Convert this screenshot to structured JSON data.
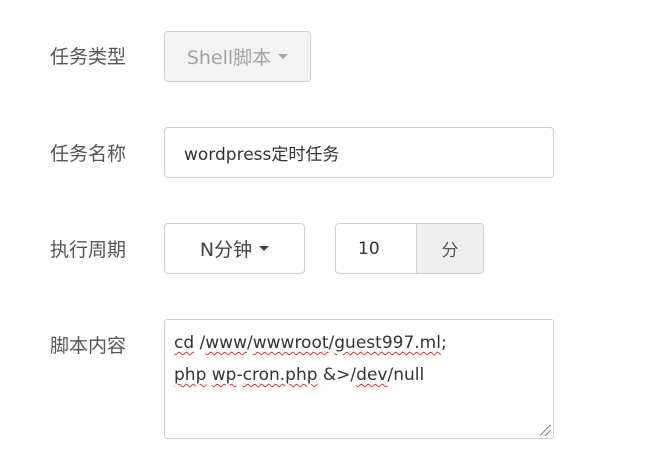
{
  "form": {
    "task_type": {
      "label": "任务类型",
      "value": "Shell脚本"
    },
    "task_name": {
      "label": "任务名称",
      "value": "wordpress定时任务"
    },
    "period": {
      "label": "执行周期",
      "value": "N分钟",
      "minutes": "10",
      "unit": "分"
    },
    "script": {
      "label": "脚本内容",
      "line1": {
        "p1": "cd",
        "p2": " /",
        "p3": "www",
        "p4": "/",
        "p5": "wwwroot",
        "p6": "/",
        "p7": "guest997.ml",
        "p8": ";"
      },
      "line2": {
        "p1": "php",
        "p2": " ",
        "p3": "wp",
        "p4": "-",
        "p5": "cron.php",
        "p6": " &>/",
        "p7": "dev",
        "p8": "/null"
      }
    }
  },
  "colors": {
    "border": "#cfcfcf",
    "disabled_bg": "#f3f3f3",
    "addon_bg": "#eeeeee",
    "spellcheck": "#e23333"
  }
}
